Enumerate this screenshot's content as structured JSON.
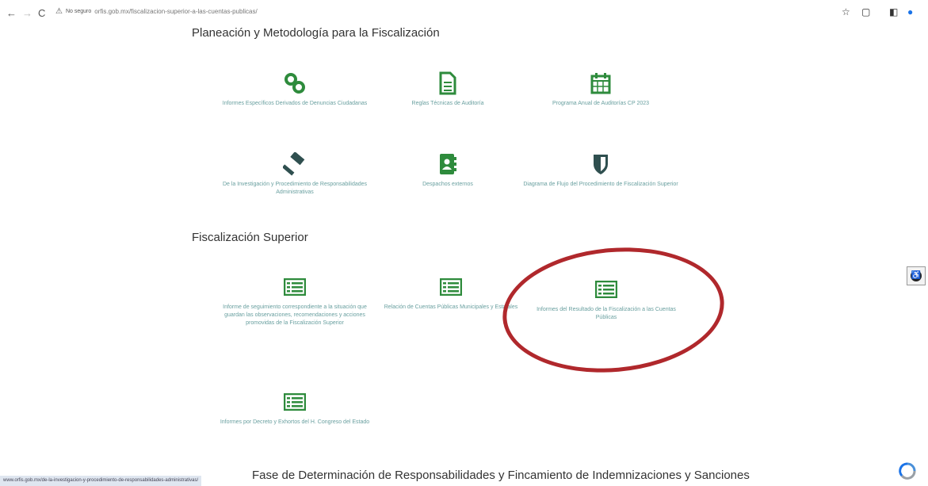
{
  "browser": {
    "back": "←",
    "forward": "→",
    "reload": "C",
    "security_label": "No seguro",
    "url": "orfis.gob.mx/fiscalizacion-superior-a-las-cuentas-publicas/"
  },
  "sections": {
    "planeacion": {
      "title": "Planeación y Metodología para la Fiscalización",
      "tiles": [
        {
          "label": "Informes Específicos Derivados de Denuncias Ciudadanas",
          "icon": "chain-link-icon"
        },
        {
          "label": "Reglas Técnicas de Auditoría",
          "icon": "document-icon"
        },
        {
          "label": "Programa Anual de Auditorías CP 2023",
          "icon": "calendar-icon"
        },
        {
          "label": "De la Investigación y Procedimiento de Responsabilidades Administrativas",
          "icon": "gavel-icon"
        },
        {
          "label": "Despachos externos",
          "icon": "address-book-icon"
        },
        {
          "label": "Diagrama de Flujo del Procedimiento de Fiscalización Superior",
          "icon": "shield-icon"
        }
      ]
    },
    "fiscalizacion": {
      "title": "Fiscalización Superior",
      "tiles": [
        {
          "label": "Informe de seguimiento correspondiente a la situación que guardan las observaciones, recomendaciones y acciones promovidas de la Fiscalización Superior",
          "icon": "list-icon"
        },
        {
          "label": "Relación de Cuentas Públicas Municipales y Estatales",
          "icon": "list-icon"
        },
        {
          "label": "Informes del Resultado de la Fiscalización a las Cuentas Públicas",
          "icon": "list-icon"
        },
        {
          "label": "Informes por Decreto y Exhortos del H. Congreso del Estado",
          "icon": "list-icon"
        }
      ]
    },
    "fase": {
      "title": "Fase de Determinación de Responsabilidades y Fincamiento de Indemnizaciones y Sanciones"
    }
  },
  "status_bar": "www.orfis.gob.mx/de-la-investigacion-y-procedimiento-de-responsabilidades-administrativas/",
  "colors": {
    "icon_green": "#2e8b3c",
    "label_teal": "#6aa0a0",
    "annotation_red": "#b0282c"
  }
}
